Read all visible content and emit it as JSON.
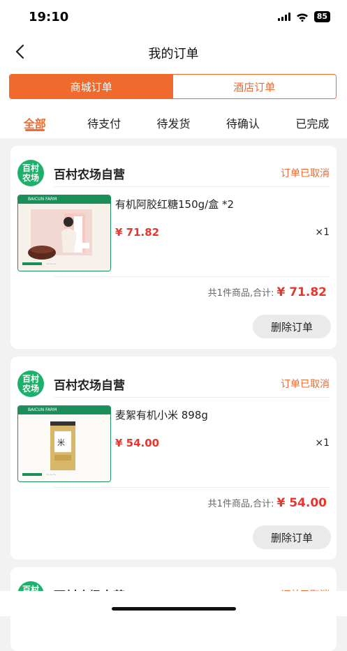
{
  "status_bar": {
    "time": "19:10",
    "battery": "85"
  },
  "nav": {
    "title": "我的订单"
  },
  "segments": [
    {
      "label": "商城订单",
      "active": true
    },
    {
      "label": "酒店订单",
      "active": false
    }
  ],
  "tabs": [
    {
      "label": "全部",
      "active": true
    },
    {
      "label": "待支付",
      "active": false
    },
    {
      "label": "待发货",
      "active": false
    },
    {
      "label": "待确认",
      "active": false
    },
    {
      "label": "已完成",
      "active": false
    }
  ],
  "orders": [
    {
      "store_logo": "百村\n农场",
      "store_name": "百村农场自营",
      "status": "订单已取消",
      "product_name": "有机阿胶红糖150g/盒 *2",
      "price": "¥ 71.82",
      "qty": "×1",
      "summary_label": "共1件商品,合计:",
      "total": "¥ 71.82",
      "delete_label": "删除订单",
      "thumb_brand": "BAICUN FARM",
      "thumb_kind": "brown-sugar"
    },
    {
      "store_logo": "百村\n农场",
      "store_name": "百村农场自营",
      "status": "订单已取消",
      "product_name": "麦絮有机小米 898g",
      "price": "¥ 54.00",
      "qty": "×1",
      "summary_label": "共1件商品,合计:",
      "total": "¥ 54.00",
      "delete_label": "删除订单",
      "thumb_brand": "BAICUN FARM",
      "thumb_kind": "millet"
    },
    {
      "store_logo": "百村\n农场",
      "store_name": "百村农场自营",
      "status": "订单已取消"
    }
  ],
  "colors": {
    "accent": "#f06a2e",
    "price": "#e8352d",
    "brand_green": "#1db06a"
  }
}
